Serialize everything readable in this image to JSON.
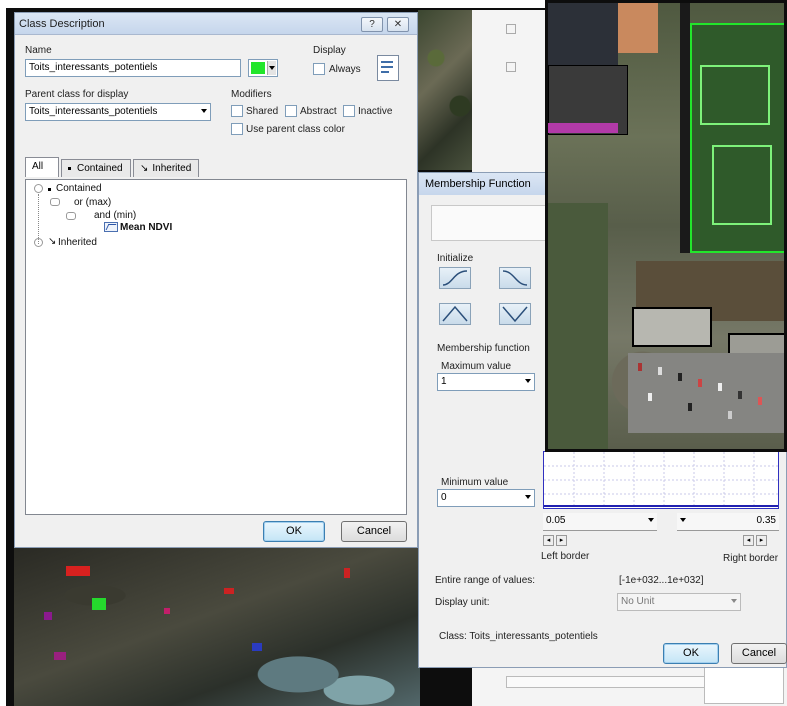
{
  "class_description": {
    "title": "Class Description",
    "help_btn": "?",
    "close_btn": "✕",
    "name_label": "Name",
    "name_value": "Toits_interessants_potentiels",
    "display_label": "Display",
    "always_label": "Always",
    "parent_label": "Parent class for display",
    "parent_value": "Toits_interessants_potentiels",
    "modifiers_label": "Modifiers",
    "shared_label": "Shared",
    "abstract_label": "Abstract",
    "inactive_label": "Inactive",
    "use_parent_color_label": "Use parent class color",
    "class_color": "#22e62b",
    "tabs": [
      {
        "label": "All"
      },
      {
        "label": "Contained"
      },
      {
        "label": "Inherited"
      }
    ],
    "tree": {
      "contained": "Contained",
      "or": "or (max)",
      "and": "and (min)",
      "feature": "Mean NDVI",
      "inherited": "Inherited"
    },
    "ok": "OK",
    "cancel": "Cancel"
  },
  "membership": {
    "title": "Membership Function",
    "initialize_label": "Initialize",
    "membership_function_label": "Membership function",
    "maximum_label": "Maximum value",
    "maximum_value": "1",
    "minimum_label": "Minimum value",
    "minimum_value": "0",
    "left_border_value": "0.05",
    "right_border_value": "0.35",
    "left_border_label": "Left border",
    "right_border_label": "Right border",
    "entire_range_label": "Entire range of values:",
    "entire_range_value": "[-1e+032...1e+032]",
    "display_unit_label": "Display unit:",
    "display_unit_value": "No Unit",
    "class_label": "Class: Toits_interessants_potentiels",
    "ok": "OK",
    "cancel": "Cancel"
  },
  "colors": {
    "accent_green": "#22e62b",
    "titlebar": "#c6d6ec",
    "graph_border": "#3030c0"
  }
}
